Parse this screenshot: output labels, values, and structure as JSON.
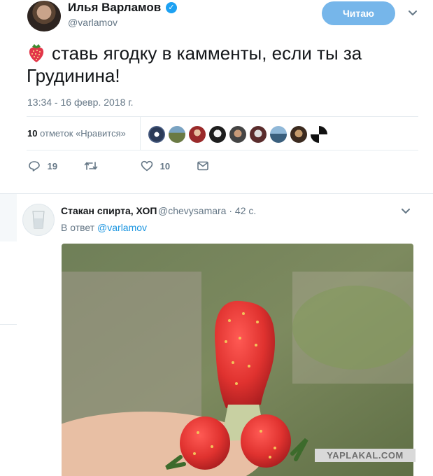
{
  "tweet": {
    "author_name": "Илья Варламов",
    "author_handle": "@varlamov",
    "follow_label": "Читаю",
    "text": "ставь ягодку в камменты, если ты за Грудинина!",
    "timestamp": "13:34 - 16 февр. 2018 г.",
    "likes": {
      "count": "10",
      "label": "отметок «Нравится»"
    },
    "actions": {
      "replies": "19",
      "likes": "10"
    }
  },
  "reply": {
    "author_name": "Стакан спирта, ХОП",
    "author_handle": "@chevysamara · 42 с.",
    "reply_to_prefix": "В ответ",
    "reply_to_handle": "@varlamov"
  },
  "watermark": "YAPLAKAL.COM",
  "colors": {
    "accent": "#1da1f2",
    "follow_button": "#76b6ea",
    "secondary_text": "#657786"
  }
}
